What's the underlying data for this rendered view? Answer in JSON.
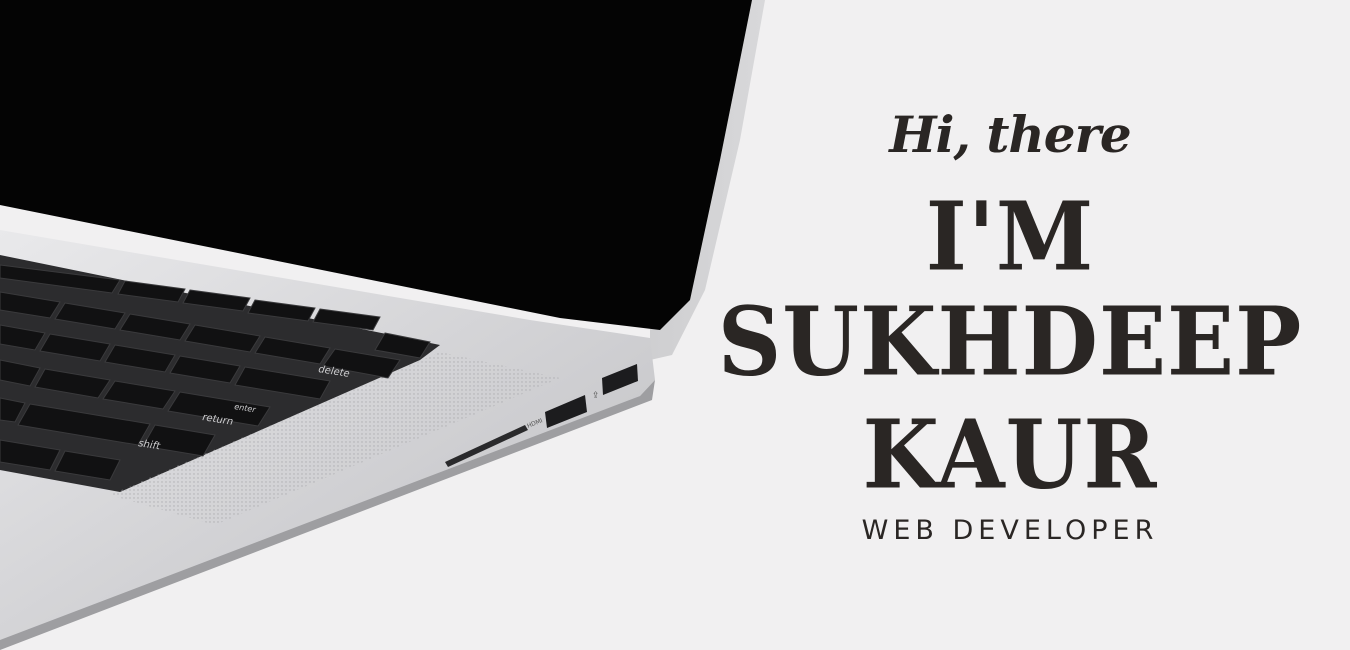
{
  "greeting": "Hi, there",
  "name_lines": [
    "I'M",
    "SUKHDEEP",
    "KAUR"
  ],
  "subtitle": "WEB DEVELOPER",
  "colors": {
    "background": "#f1f0f1",
    "text": "#2a2624",
    "screen": "#040404",
    "laptop_body": "#d4d4d6"
  },
  "photo": {
    "keyboard_keys": [
      "delete",
      "return",
      "enter",
      "shift"
    ],
    "port_label": "HDMI"
  }
}
